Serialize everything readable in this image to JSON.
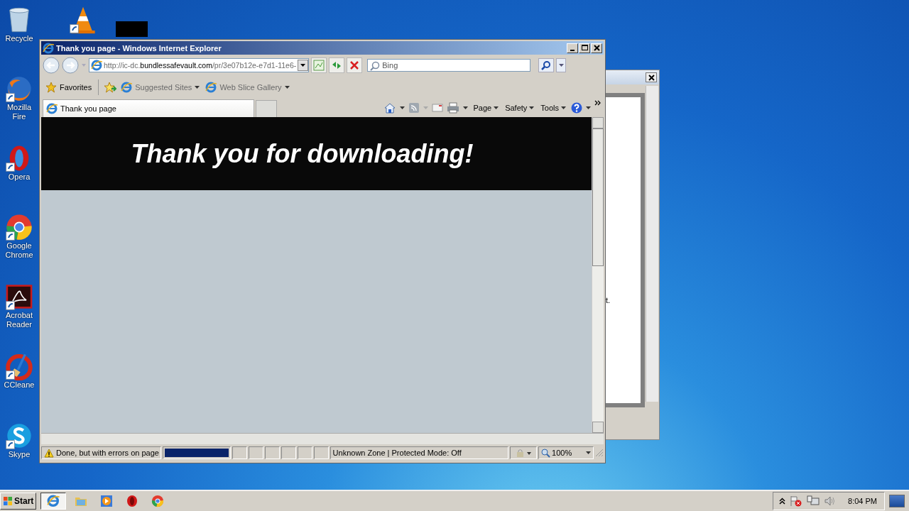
{
  "desktop_icons": [
    {
      "kind": "recycle",
      "label": "Recycle"
    },
    {
      "kind": "vlc"
    },
    {
      "kind": "firefox",
      "label": "Mozilla Fire"
    },
    {
      "kind": "opera",
      "label": "Opera"
    },
    {
      "kind": "chrome",
      "label": "Google Chrome"
    },
    {
      "kind": "acrobat",
      "label": "Acrobat Reader"
    },
    {
      "kind": "ccleaner",
      "label": "CCleane"
    },
    {
      "kind": "skype",
      "label": "Skype"
    }
  ],
  "back_window": {
    "fragment": "t."
  },
  "browser": {
    "title": "Thank you page - Windows Internet Explorer",
    "address": {
      "prefix": "http://ic-dc.",
      "domain": "bundlessafevault.com",
      "rest": "/pr/3e07b12e-e7d1-11e6-"
    },
    "search": {
      "placeholder": "Bing"
    },
    "favorites": [
      {
        "label": "Favorites",
        "kind": "star"
      },
      {
        "label": "Suggested Sites",
        "kind": "ie"
      },
      {
        "label": "Web Slice Gallery",
        "kind": "ie"
      }
    ],
    "tabs": [
      {
        "label": "Thank you page",
        "selected": true
      }
    ],
    "commands": [
      "Page",
      "Safety",
      "Tools"
    ],
    "page": {
      "heading": "Thank you for downloading!"
    },
    "status_bar": {
      "message": "Done, but with errors on page",
      "progress": {
        "level": 1
      },
      "zone": "Unknown Zone | Protected Mode: Off",
      "zoom": "100%"
    }
  },
  "taskbar": {
    "start": "Start",
    "items": [
      {
        "kind": "ie",
        "selected": true
      },
      {
        "kind": "folder",
        "selected": false
      },
      {
        "kind": "media",
        "selected": false
      },
      {
        "kind": "opera",
        "selected": false
      },
      {
        "kind": "chrome",
        "selected": false
      }
    ],
    "clock": "8:04 PM"
  }
}
